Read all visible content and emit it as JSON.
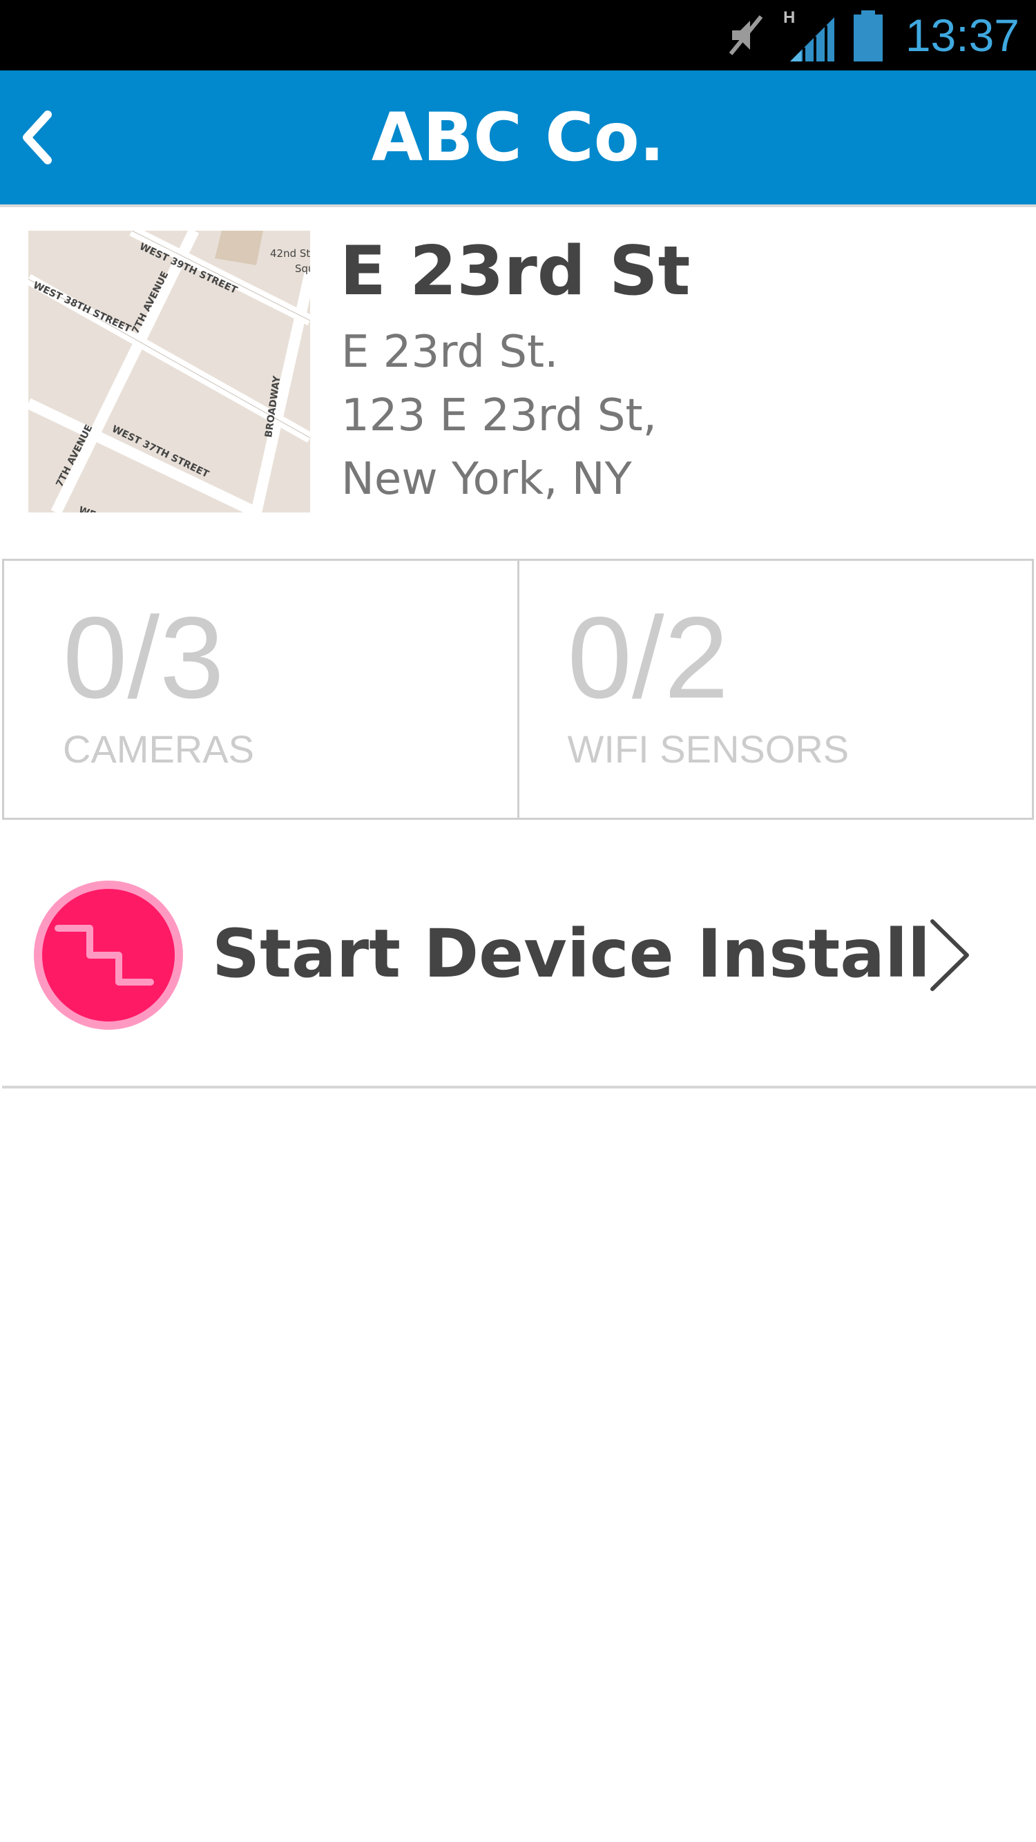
{
  "status_bar": {
    "time": "13:37",
    "icons": [
      "mute-icon",
      "signal-h-icon",
      "battery-icon"
    ],
    "network_label": "H"
  },
  "app_bar": {
    "title": "ABC Co.",
    "back_icon": "chevron-left-icon",
    "color": "#0288cc"
  },
  "location": {
    "name": "E 23rd St",
    "address_lines": [
      "E 23rd St.",
      "123 E 23rd St,",
      "New York, NY"
    ],
    "map": {
      "street_labels": [
        "WEST 39TH STREET",
        "WEST 38TH STREET",
        "WEST 37TH STREET",
        "7TH AVENUE",
        "7TH AVENUE",
        "BROADWAY",
        "42nd Str",
        "Squ",
        "WES"
      ]
    }
  },
  "stats": [
    {
      "count": "0/3",
      "label": "CAMERAS"
    },
    {
      "count": "0/2",
      "label": "WIFI SENSORS"
    }
  ],
  "install": {
    "label": "Start Device Install",
    "icon": "stairs-icon",
    "accent_color": "#ff1a66",
    "chevron_icon": "chevron-right-icon"
  }
}
